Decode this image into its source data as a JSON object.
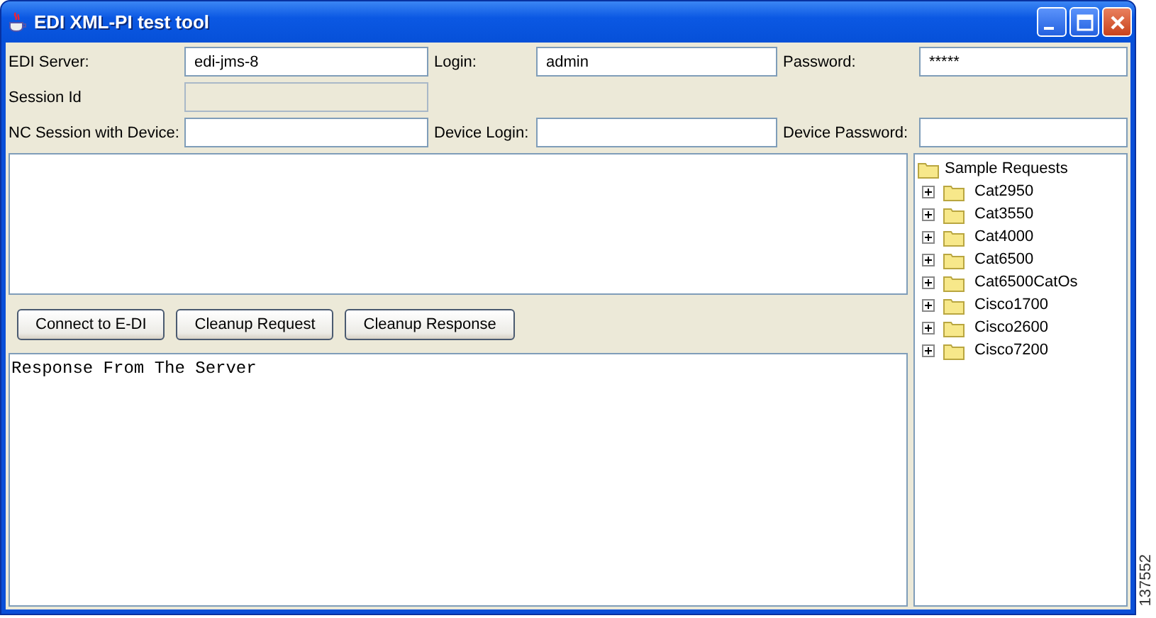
{
  "window": {
    "title": "EDI XML-PI test tool"
  },
  "form": [
    {
      "label": "EDI Server:",
      "value": "edi-jms-8",
      "disabled": false
    },
    {
      "label": "Login:",
      "value": "admin",
      "disabled": false
    },
    {
      "label": "Password:",
      "value": "*****",
      "disabled": false
    },
    {
      "label": "Session Id",
      "disabled": true
    },
    {
      "label": "NC Session with Device:",
      "disabled": false
    },
    {
      "label": "Device Login:",
      "disabled": false
    },
    {
      "label": "Device Password:",
      "disabled": false
    }
  ],
  "buttons": [
    "Connect to E-DI",
    "Cleanup Request",
    "Cleanup Response"
  ],
  "response": {
    "text": "Response From The Server"
  },
  "tree": {
    "label": "Sample Requests",
    "children": [
      {
        "label": "Cat2950",
        "expanded": false
      },
      {
        "label": "Cat3550",
        "expanded": false
      },
      {
        "label": "Cat4000",
        "expanded": false
      },
      {
        "label": "Cat6500",
        "expanded": false
      },
      {
        "label": "Cat6500CatOs",
        "expanded": false
      },
      {
        "label": "Cisco1700",
        "expanded": false
      },
      {
        "label": "Cisco2600",
        "expanded": false
      },
      {
        "label": "Cisco7200",
        "expanded": false
      }
    ]
  },
  "figure_number": "137552"
}
